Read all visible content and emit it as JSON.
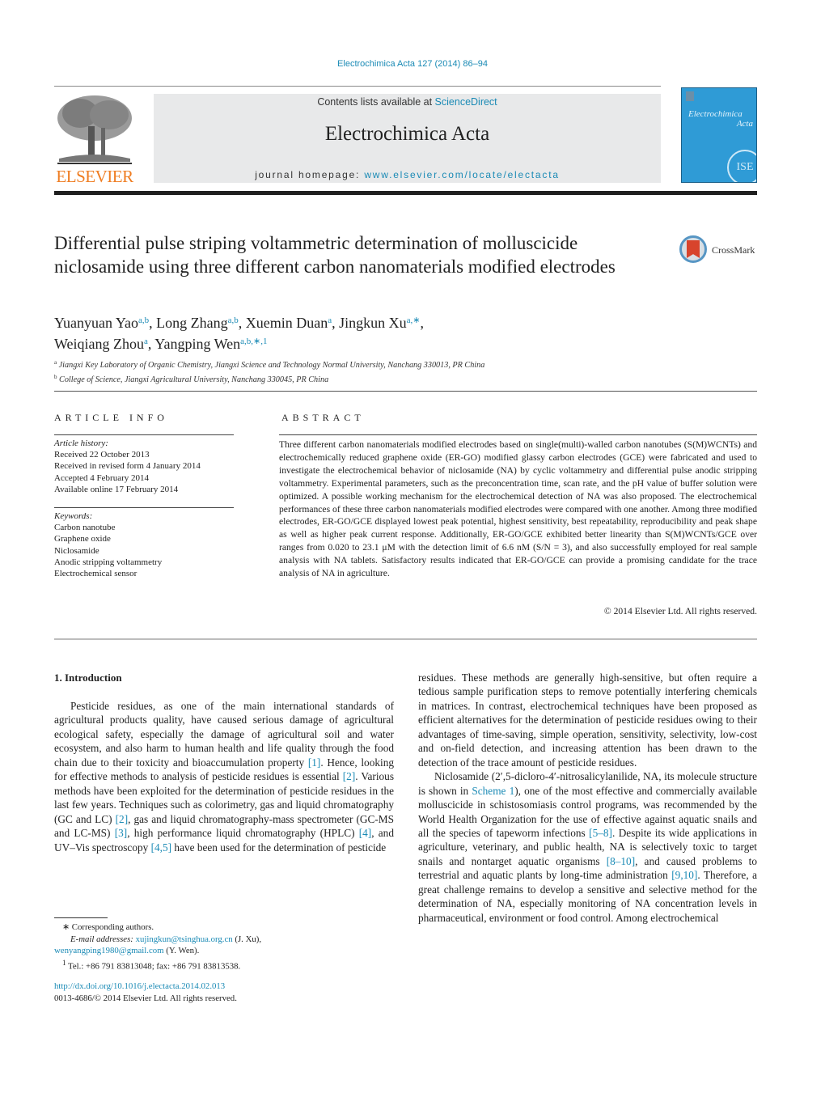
{
  "header": {
    "citation": "Electrochimica Acta 127 (2014) 86–94",
    "contents_prefix": "Contents lists available at ",
    "contents_link": "ScienceDirect",
    "journal_name": "Electrochimica Acta",
    "homepage_prefix": "journal homepage: ",
    "homepage_link": "www.elsevier.com/locate/electacta",
    "publisher_logo": "ELSEVIER",
    "cover_title_line1": "Electrochimica",
    "cover_title_line2": "Acta",
    "cover_badge": "ISE",
    "crossmark_label": "CrossMark",
    "accent_link_color": "#1a8ab5",
    "publisher_color": "#ef7d22"
  },
  "article": {
    "title": "Differential pulse striping voltammetric determination of molluscicide niclosamide using three different carbon nanomaterials modified electrodes",
    "authors": [
      {
        "name": "Yuanyuan Yao",
        "sup": "a,b",
        "sep": ", "
      },
      {
        "name": "Long Zhang",
        "sup": "a,b",
        "sep": ", "
      },
      {
        "name": "Xuemin Duan",
        "sup": "a",
        "sep": ", "
      },
      {
        "name": "Jingkun Xu",
        "sup": "a,∗",
        "sep": ","
      },
      {
        "name": "Weiqiang Zhou",
        "sup": "a",
        "sep": ", "
      },
      {
        "name": "Yangping Wen",
        "sup": "a,b,∗,1",
        "sep": ""
      }
    ],
    "affiliations": [
      {
        "mark": "a",
        "text": "Jiangxi Key Laboratory of Organic Chemistry, Jiangxi Science and Technology Normal University, Nanchang 330013, PR China"
      },
      {
        "mark": "b",
        "text": "College of Science, Jiangxi Agricultural University, Nanchang 330045, PR China"
      }
    ]
  },
  "article_info": {
    "heading": "ARTICLE INFO",
    "history_label": "Article history:",
    "history": [
      "Received 22 October 2013",
      "Received in revised form 4 January 2014",
      "Accepted 4 February 2014",
      "Available online 17 February 2014"
    ],
    "keywords_label": "Keywords:",
    "keywords": [
      "Carbon nanotube",
      "Graphene oxide",
      "Niclosamide",
      "Anodic stripping voltammetry",
      "Electrochemical sensor"
    ]
  },
  "abstract": {
    "heading": "ABSTRACT",
    "text": "Three different carbon nanomaterials modified electrodes based on single(multi)-walled carbon nanotubes (S(M)WCNTs) and electrochemically reduced graphene oxide (ER-GO) modified glassy carbon electrodes (GCE) were fabricated and used to investigate the electrochemical behavior of niclosamide (NA) by cyclic voltammetry and differential pulse anodic stripping voltammetry. Experimental parameters, such as the preconcentration time, scan rate, and the pH value of buffer solution were optimized. A possible working mechanism for the electrochemical detection of NA was also proposed. The electrochemical performances of these three carbon nanomaterials modified electrodes were compared with one another. Among three modified electrodes, ER-GO/GCE displayed lowest peak potential, highest sensitivity, best repeatability, reproducibility and peak shape as well as higher peak current response. Additionally, ER-GO/GCE exhibited better linearity than S(M)WCNTs/GCE over ranges from 0.020 to 23.1 μM with the detection limit of 6.6 nM (S/N = 3), and also successfully employed for real sample analysis with NA tablets. Satisfactory results indicated that ER-GO/GCE can provide a promising candidate for the trace analysis of NA in agriculture.",
    "copyright": "© 2014 Elsevier Ltd. All rights reserved."
  },
  "introduction": {
    "heading": "1.  Introduction",
    "left_paragraph": [
      {
        "t": "Pesticide residues, as one of the main international standards of agricultural products quality, have caused serious damage of agricultural ecological safety, especially the damage of agricultural soil and water ecosystem, and also harm to human health and life quality through the food chain due to their toxicity and bioaccumulation property "
      },
      {
        "ref": "[1]"
      },
      {
        "t": ". Hence, looking for effective methods to analysis of pesticide residues is essential "
      },
      {
        "ref": "[2]"
      },
      {
        "t": ". Various methods have been exploited for the determination of pesticide residues in the last few years. Techniques such as colorimetry, gas and liquid chromatography (GC and LC) "
      },
      {
        "ref": "[2]"
      },
      {
        "t": ", gas and liquid chromatography-mass spectrometer (GC-MS and LC-MS) "
      },
      {
        "ref": "[3]"
      },
      {
        "t": ", high performance liquid chromatography (HPLC) "
      },
      {
        "ref": "[4]"
      },
      {
        "t": ", and UV–Vis spectroscopy "
      },
      {
        "ref": "[4,5]"
      },
      {
        "t": " have been used for the determination of pesticide"
      }
    ],
    "right_paragraph_1": "residues. These methods are generally high-sensitive, but often require a tedious sample purification steps to remove potentially interfering chemicals in matrices. In contrast, electrochemical techniques have been proposed as efficient alternatives for the determination of pesticide residues owing to their advantages of time-saving, simple operation, sensitivity, selectivity, low-cost and on-field detection, and increasing attention has been drawn to the detection of the trace amount of pesticide residues.",
    "right_paragraph_2": [
      {
        "t": "Niclosamide (2′,5-dicloro-4′-nitrosalicylanilide, NA, its molecule structure is shown in "
      },
      {
        "ref": "Scheme 1"
      },
      {
        "t": "), one of the most effective and commercially available molluscicide in schistosomiasis control programs, was recommended by the World Health Organization for the use of effective against aquatic snails and all the species of tapeworm infections "
      },
      {
        "ref": "[5–8]"
      },
      {
        "t": ". Despite its wide applications in agriculture, veterinary, and public health, NA is selectively toxic to target snails and nontarget aquatic organisms "
      },
      {
        "ref": "[8–10]"
      },
      {
        "t": ", and caused problems to terrestrial and aquatic plants by long-time administration "
      },
      {
        "ref": "[9,10]"
      },
      {
        "t": ". Therefore, a great challenge remains to develop a sensitive and selective method for the determination of NA, especially monitoring of NA concentration levels in pharmaceutical, environment or food control. Among electrochemical"
      }
    ]
  },
  "footnotes": {
    "corresponding": "∗  Corresponding authors.",
    "email_label": "E-mail addresses: ",
    "email1": "xujingkun@tsinghua.org.cn",
    "email1_owner": " (J. Xu),",
    "email2": "wenyangping1980@gmail.com",
    "email2_owner": " (Y. Wen).",
    "tel_mark": "1",
    "tel": " Tel.: +86 791 83813048; fax: +86 791 83813538.",
    "doi": "http://dx.doi.org/10.1016/j.electacta.2014.02.013",
    "issn": "0013-4686/© 2014 Elsevier Ltd. All rights reserved."
  }
}
